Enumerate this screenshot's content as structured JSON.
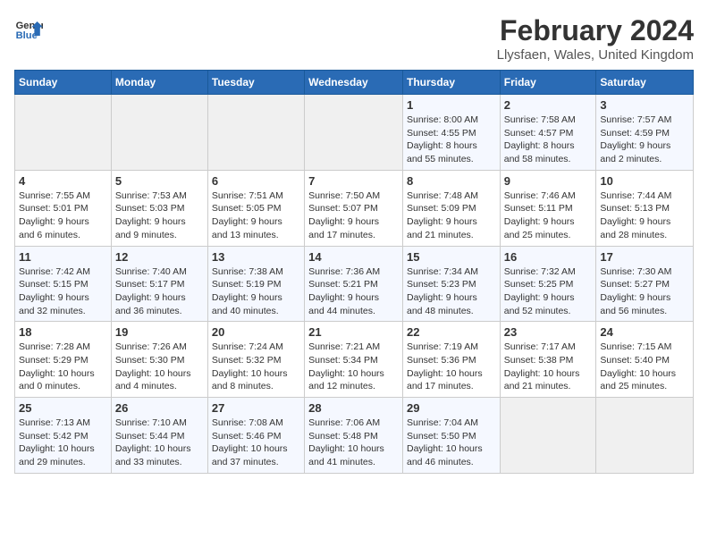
{
  "logo": {
    "line1": "General",
    "line2": "Blue"
  },
  "title": "February 2024",
  "location": "Llysfaen, Wales, United Kingdom",
  "days_header": [
    "Sunday",
    "Monday",
    "Tuesday",
    "Wednesday",
    "Thursday",
    "Friday",
    "Saturday"
  ],
  "weeks": [
    [
      {
        "num": "",
        "info": ""
      },
      {
        "num": "",
        "info": ""
      },
      {
        "num": "",
        "info": ""
      },
      {
        "num": "",
        "info": ""
      },
      {
        "num": "1",
        "info": "Sunrise: 8:00 AM\nSunset: 4:55 PM\nDaylight: 8 hours\nand 55 minutes."
      },
      {
        "num": "2",
        "info": "Sunrise: 7:58 AM\nSunset: 4:57 PM\nDaylight: 8 hours\nand 58 minutes."
      },
      {
        "num": "3",
        "info": "Sunrise: 7:57 AM\nSunset: 4:59 PM\nDaylight: 9 hours\nand 2 minutes."
      }
    ],
    [
      {
        "num": "4",
        "info": "Sunrise: 7:55 AM\nSunset: 5:01 PM\nDaylight: 9 hours\nand 6 minutes."
      },
      {
        "num": "5",
        "info": "Sunrise: 7:53 AM\nSunset: 5:03 PM\nDaylight: 9 hours\nand 9 minutes."
      },
      {
        "num": "6",
        "info": "Sunrise: 7:51 AM\nSunset: 5:05 PM\nDaylight: 9 hours\nand 13 minutes."
      },
      {
        "num": "7",
        "info": "Sunrise: 7:50 AM\nSunset: 5:07 PM\nDaylight: 9 hours\nand 17 minutes."
      },
      {
        "num": "8",
        "info": "Sunrise: 7:48 AM\nSunset: 5:09 PM\nDaylight: 9 hours\nand 21 minutes."
      },
      {
        "num": "9",
        "info": "Sunrise: 7:46 AM\nSunset: 5:11 PM\nDaylight: 9 hours\nand 25 minutes."
      },
      {
        "num": "10",
        "info": "Sunrise: 7:44 AM\nSunset: 5:13 PM\nDaylight: 9 hours\nand 28 minutes."
      }
    ],
    [
      {
        "num": "11",
        "info": "Sunrise: 7:42 AM\nSunset: 5:15 PM\nDaylight: 9 hours\nand 32 minutes."
      },
      {
        "num": "12",
        "info": "Sunrise: 7:40 AM\nSunset: 5:17 PM\nDaylight: 9 hours\nand 36 minutes."
      },
      {
        "num": "13",
        "info": "Sunrise: 7:38 AM\nSunset: 5:19 PM\nDaylight: 9 hours\nand 40 minutes."
      },
      {
        "num": "14",
        "info": "Sunrise: 7:36 AM\nSunset: 5:21 PM\nDaylight: 9 hours\nand 44 minutes."
      },
      {
        "num": "15",
        "info": "Sunrise: 7:34 AM\nSunset: 5:23 PM\nDaylight: 9 hours\nand 48 minutes."
      },
      {
        "num": "16",
        "info": "Sunrise: 7:32 AM\nSunset: 5:25 PM\nDaylight: 9 hours\nand 52 minutes."
      },
      {
        "num": "17",
        "info": "Sunrise: 7:30 AM\nSunset: 5:27 PM\nDaylight: 9 hours\nand 56 minutes."
      }
    ],
    [
      {
        "num": "18",
        "info": "Sunrise: 7:28 AM\nSunset: 5:29 PM\nDaylight: 10 hours\nand 0 minutes."
      },
      {
        "num": "19",
        "info": "Sunrise: 7:26 AM\nSunset: 5:30 PM\nDaylight: 10 hours\nand 4 minutes."
      },
      {
        "num": "20",
        "info": "Sunrise: 7:24 AM\nSunset: 5:32 PM\nDaylight: 10 hours\nand 8 minutes."
      },
      {
        "num": "21",
        "info": "Sunrise: 7:21 AM\nSunset: 5:34 PM\nDaylight: 10 hours\nand 12 minutes."
      },
      {
        "num": "22",
        "info": "Sunrise: 7:19 AM\nSunset: 5:36 PM\nDaylight: 10 hours\nand 17 minutes."
      },
      {
        "num": "23",
        "info": "Sunrise: 7:17 AM\nSunset: 5:38 PM\nDaylight: 10 hours\nand 21 minutes."
      },
      {
        "num": "24",
        "info": "Sunrise: 7:15 AM\nSunset: 5:40 PM\nDaylight: 10 hours\nand 25 minutes."
      }
    ],
    [
      {
        "num": "25",
        "info": "Sunrise: 7:13 AM\nSunset: 5:42 PM\nDaylight: 10 hours\nand 29 minutes."
      },
      {
        "num": "26",
        "info": "Sunrise: 7:10 AM\nSunset: 5:44 PM\nDaylight: 10 hours\nand 33 minutes."
      },
      {
        "num": "27",
        "info": "Sunrise: 7:08 AM\nSunset: 5:46 PM\nDaylight: 10 hours\nand 37 minutes."
      },
      {
        "num": "28",
        "info": "Sunrise: 7:06 AM\nSunset: 5:48 PM\nDaylight: 10 hours\nand 41 minutes."
      },
      {
        "num": "29",
        "info": "Sunrise: 7:04 AM\nSunset: 5:50 PM\nDaylight: 10 hours\nand 46 minutes."
      },
      {
        "num": "",
        "info": ""
      },
      {
        "num": "",
        "info": ""
      }
    ]
  ]
}
